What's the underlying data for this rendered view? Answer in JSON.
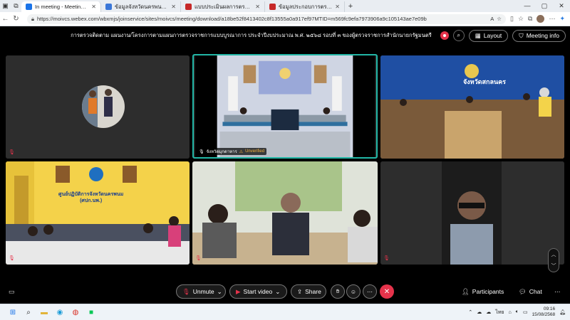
{
  "browser": {
    "tabs": [
      {
        "label": "In meeting - Meeting - Webex",
        "active": true,
        "color": "#1a73e8"
      },
      {
        "label": "ข้อมูลจังหวัดนครพนม.pdf",
        "active": false,
        "color": "#3b77d8"
      },
      {
        "label": "แบบประเมินผลการตรวจราชการ รอบ 3 ศกคม",
        "active": false,
        "color": "#c62828"
      },
      {
        "label": "ข้อมูลประกอบการตรวจบูรณาการ มกรา",
        "active": false,
        "color": "#c62828"
      }
    ],
    "url": "https://moivcs.webex.com/wbxmjs/joinservice/sites/moivcs/meeting/download/a18be52f8413402c8f13555a0a917ef97MTID=m569fc9efa7973906a9c105143ae7e09b"
  },
  "meeting": {
    "title": "การตรวจติดตาม แผนงาน/โครงการตามแผนการตรวจราชการแบบบูรณาการ ประจำปีงบประมาณ พ.ศ. ๒๕๖๘ รอบที่ ๓ ของผู้ตรวจราชการสำนักนายกรัฐมนตรี",
    "layout_label": "Layout",
    "info_label": "Meeting info",
    "accent": "#22b6a6",
    "record_color": "#e5334b"
  },
  "tiles": [
    {
      "id": "t1",
      "name": "",
      "muted": true
    },
    {
      "id": "t2",
      "name": "จังหวัดมุกดาหาร",
      "tag": "Unverified",
      "muted": false,
      "active": true
    },
    {
      "id": "t3",
      "name": "",
      "muted": false,
      "banner": "จังหวัดสกลนคร"
    },
    {
      "id": "t4",
      "name": "",
      "muted": true,
      "banner": "ศูนย์ปฏิบัติการจังหวัดนครพนม",
      "banner2": "(ศปก.นพ.)"
    },
    {
      "id": "t5",
      "name": "",
      "muted": true
    },
    {
      "id": "t6",
      "name": "",
      "muted": true
    }
  ],
  "controls": {
    "unmute": "Unmute",
    "start_video": "Start video",
    "share": "Share",
    "participants": "Participants",
    "chat": "Chat"
  },
  "taskbar": {
    "lang": "ไทย",
    "time": "09:16",
    "date": "15/08/2568"
  }
}
